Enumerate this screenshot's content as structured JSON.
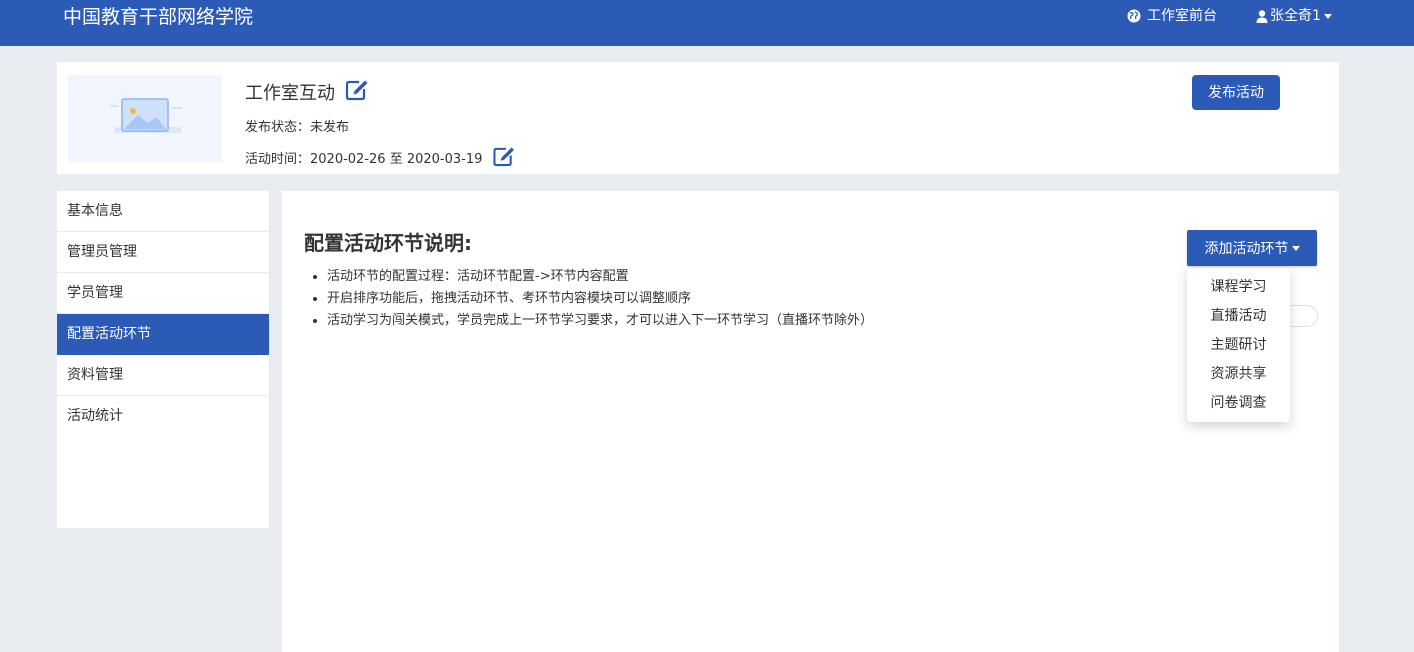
{
  "header": {
    "brand": "中国教育干部网络学院",
    "studio_link": "工作室前台",
    "user_name": "张全奇1",
    "studio_icon": "globe-icon",
    "user_icon": "user-icon"
  },
  "activity": {
    "title": "工作室互动",
    "status_label": "发布状态：",
    "status_value": "未发布",
    "time_label": "活动时间：",
    "time_value": "2020-02-26 至 2020-03-19",
    "publish_button": "发布活动",
    "thumbnail_icon": "image-placeholder-icon"
  },
  "sidebar": {
    "items": [
      {
        "label": "基本信息",
        "active": false
      },
      {
        "label": "管理员管理",
        "active": false
      },
      {
        "label": "学员管理",
        "active": false
      },
      {
        "label": "配置活动环节",
        "active": true
      },
      {
        "label": "资料管理",
        "active": false
      },
      {
        "label": "活动统计",
        "active": false
      }
    ]
  },
  "main": {
    "title": "配置活动环节说明:",
    "notes": [
      "活动环节的配置过程：活动环节配置->环节内容配置",
      "开启排序功能后，拖拽活动环节、考环节内容模块可以调整顺序",
      "活动学习为闯关模式，学员完成上一环节学习要求，才可以进入下一环节学习（直播环节除外）"
    ],
    "add_button": "添加活动环节",
    "dropdown_items": [
      "课程学习",
      "直播活动",
      "主题研讨",
      "资源共享",
      "问卷调查"
    ]
  },
  "colors": {
    "primary": "#2c5bb7",
    "background": "#e9edf1"
  }
}
